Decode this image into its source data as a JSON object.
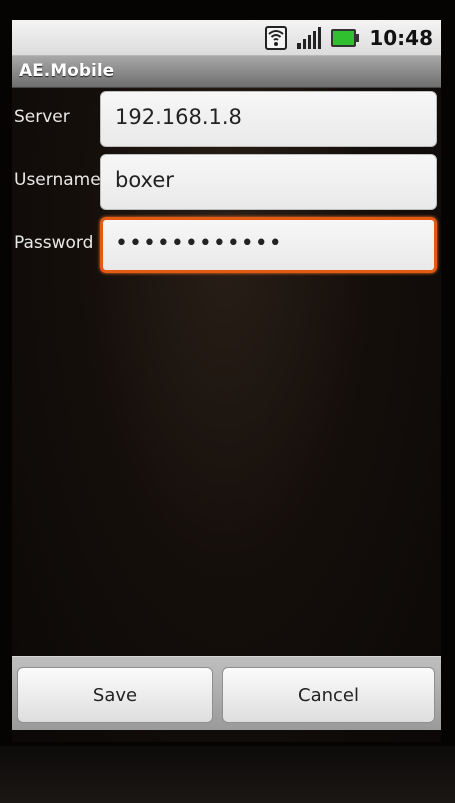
{
  "status_bar": {
    "time": "10:48",
    "icons": [
      "wifi-icon",
      "signal-icon",
      "battery-icon"
    ],
    "battery_color": "#2fbf2f"
  },
  "app": {
    "title": "AE.Mobile"
  },
  "form": {
    "server": {
      "label": "Server",
      "value": "192.168.1.8"
    },
    "username": {
      "label": "Username",
      "value": "boxer"
    },
    "password": {
      "label": "Password",
      "value": "••••••••••••"
    }
  },
  "buttons": {
    "save_label": "Save",
    "cancel_label": "Cancel"
  },
  "colors": {
    "focus_border": "#e25a14"
  }
}
